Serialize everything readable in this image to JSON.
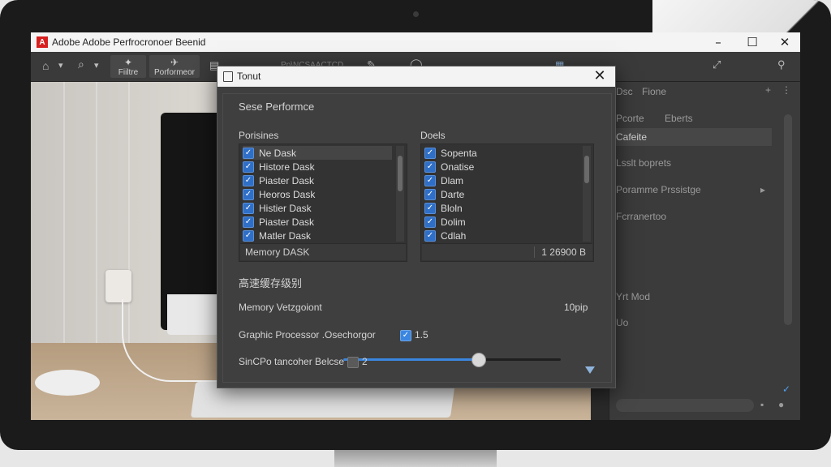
{
  "app": {
    "logo_letter": "A",
    "title": "Adobe Adobe Perfrocronoer Beenid",
    "window_controls": [
      "–",
      "☐",
      "✕"
    ]
  },
  "toolbar": {
    "btn_filters": "Fiiltre",
    "btn_performance": "Porformeor",
    "menu_faded": "Pp\\NCSAACTCD"
  },
  "right_panel": {
    "tabs": [
      "Dsc",
      "Fione"
    ],
    "items": [
      "Pcorte",
      "Eberts",
      "Cafeite",
      "Lsslt boprets",
      "Poramme Prssistge",
      "Fcrranertoo",
      "Yrt Mod",
      "Uo"
    ]
  },
  "dialog": {
    "title": "Tonut",
    "section_title": "Sese Performce",
    "left_list": {
      "header": "Porisines",
      "items": [
        "Ne Dask",
        "Histore Dask",
        "Piaster Dask",
        "Heoros Dask",
        "Histier Dask",
        "Piaster Dask",
        "Matler Dask"
      ],
      "footer": "Memory  DASK"
    },
    "right_list": {
      "header": "Doels",
      "items": [
        "Sopenta",
        "Onatise",
        "Dlam",
        "Darte",
        "Bloln",
        "Dolim",
        "Cdlah"
      ],
      "footer": "1 26900 B"
    },
    "cache_heading": "高速缓存级别",
    "memory": {
      "label": "Memory Vetzgoiont",
      "value_text": "10pip",
      "slider_fraction": 0.62
    },
    "graphic": {
      "label": "Graphic Processor .Osechorgor",
      "value": "1.5",
      "checked": true
    },
    "sindo": {
      "label": "SinCPo tancoher Belcse",
      "value": "2",
      "checked": false
    }
  },
  "colors": {
    "accent": "#3a86e0",
    "adobe_red": "#d71f1f"
  }
}
